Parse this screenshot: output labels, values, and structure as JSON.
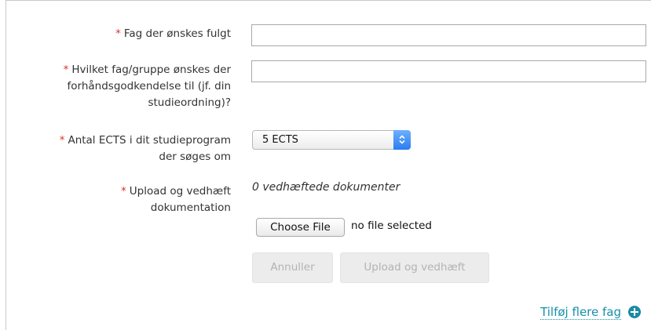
{
  "form": {
    "subject_label": "Fag der ønskes fulgt",
    "subject_value": "",
    "preapproval_label_line1": "Hvilket fag/gruppe ønskes der",
    "preapproval_label_line2": "forhåndsgodkendelse til (jf. din",
    "preapproval_label_line3": "studieordning)?",
    "preapproval_value": "",
    "ects_label_line1": "Antal ECTS i dit studieprogram",
    "ects_label_line2": "der søges om",
    "ects_selected": "5 ECTS",
    "upload_label_line1": "Upload og vedhæft",
    "upload_label_line2": "dokumentation",
    "attached_count_text": "0 vedhæftede dokumenter",
    "choose_file_label": "Choose File",
    "file_status": "no file selected",
    "cancel_label": "Annuller",
    "upload_attach_label": "Upload og vedhæft",
    "required_marker": "*"
  },
  "add_more_link": "Tilføj flere fag",
  "colors": {
    "required": "#d9342b",
    "link": "#1790a8",
    "select_accent": "#2a7cf0"
  }
}
